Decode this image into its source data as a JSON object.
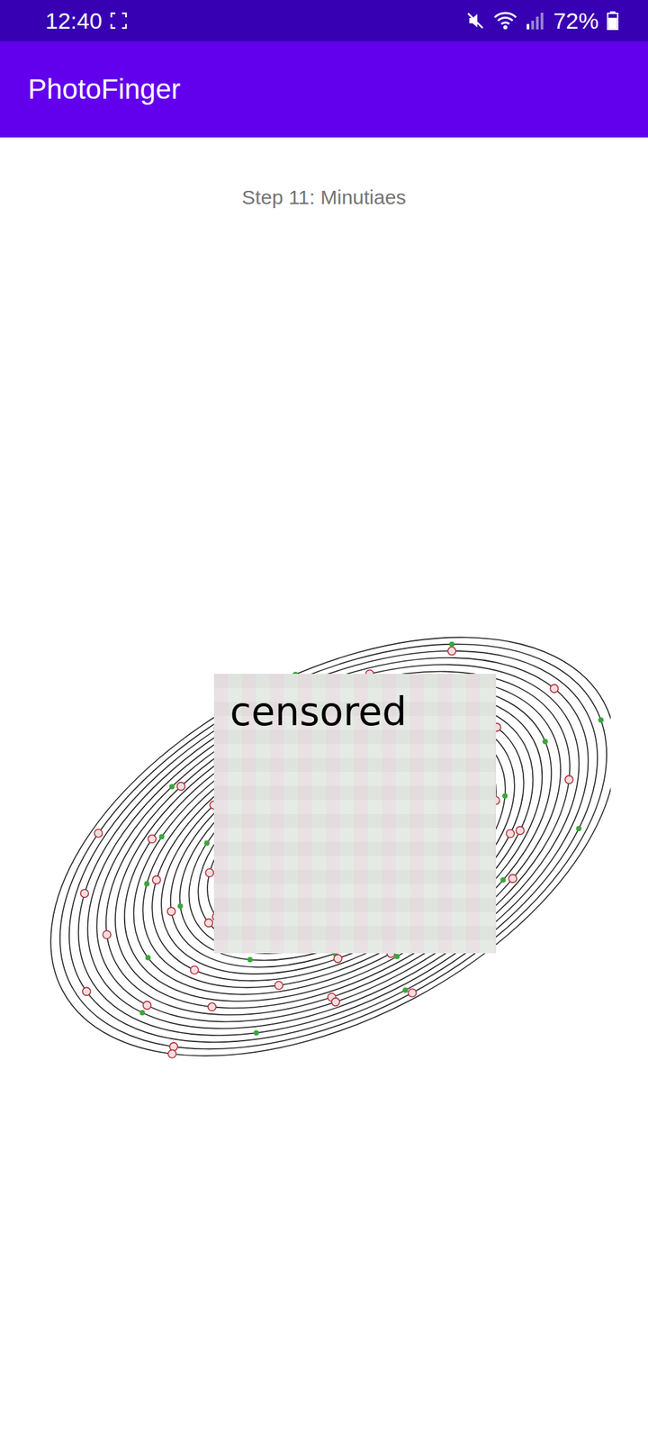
{
  "status_bar": {
    "time": "12:40",
    "battery": "72%",
    "battery_level": 0.72
  },
  "app_bar": {
    "title": "PhotoFinger"
  },
  "step": {
    "label": "Step 11: Minutiaes"
  },
  "image": {
    "overlay": {
      "label": "censored"
    }
  }
}
